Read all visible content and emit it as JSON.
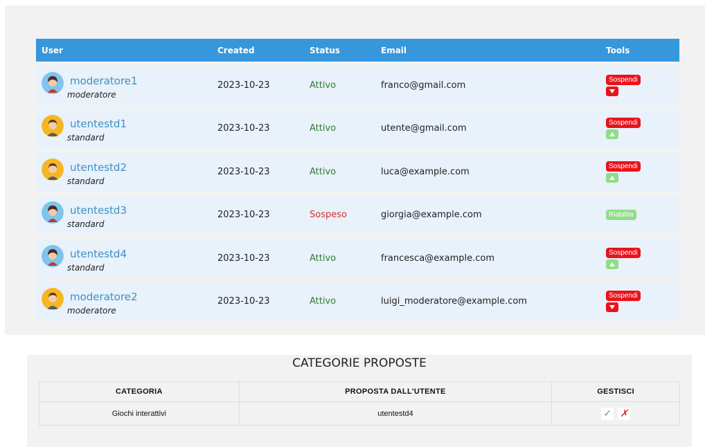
{
  "users_table": {
    "headers": {
      "user": "User",
      "created": "Created",
      "status": "Status",
      "email": "Email",
      "tools": "Tools"
    },
    "rows": [
      {
        "username": "moderatore1",
        "role": "moderatore",
        "created": "2023-10-23",
        "status": "Attivo",
        "email": "franco@gmail.com",
        "action_label": "Sospendi",
        "arrow": "down",
        "avatar": "female-avatar"
      },
      {
        "username": "utentestd1",
        "role": "standard",
        "created": "2023-10-23",
        "status": "Attivo",
        "email": "utente@gmail.com",
        "action_label": "Sospendi",
        "arrow": "up",
        "avatar": "male-avatar"
      },
      {
        "username": "utentestd2",
        "role": "standard",
        "created": "2023-10-23",
        "status": "Attivo",
        "email": "luca@example.com",
        "action_label": "Sospendi",
        "arrow": "up",
        "avatar": "male-avatar"
      },
      {
        "username": "utentestd3",
        "role": "standard",
        "created": "2023-10-23",
        "status": "Sospeso",
        "email": "giorgia@example.com",
        "action_label": "Riabilita",
        "arrow": "none",
        "avatar": "female-avatar"
      },
      {
        "username": "utentestd4",
        "role": "standard",
        "created": "2023-10-23",
        "status": "Attivo",
        "email": "francesca@example.com",
        "action_label": "Sospendi",
        "arrow": "up",
        "avatar": "female-avatar"
      },
      {
        "username": "moderatore2",
        "role": "moderatore",
        "created": "2023-10-23",
        "status": "Attivo",
        "email": "luigi_moderatore@example.com",
        "action_label": "Sospendi",
        "arrow": "down",
        "avatar": "male-avatar"
      }
    ]
  },
  "categories": {
    "title": "CATEGORIE PROPOSTE",
    "headers": {
      "category": "CATEGORIA",
      "proposed_by": "PROPOSTA DALL'UTENTE",
      "manage": "GESTISCI"
    },
    "rows": [
      {
        "category": "Giochi interattivi",
        "proposed_by": "utentestd4",
        "approve_icon": "✓",
        "reject_icon": "✗"
      }
    ]
  },
  "colors": {
    "header_blue": "#3797dd",
    "row_bg": "#e9f1fa",
    "danger_red": "#e8131b",
    "success_green": "#8fdd8a",
    "active_text": "#2e7d2e",
    "suspended_text": "#d23232"
  }
}
